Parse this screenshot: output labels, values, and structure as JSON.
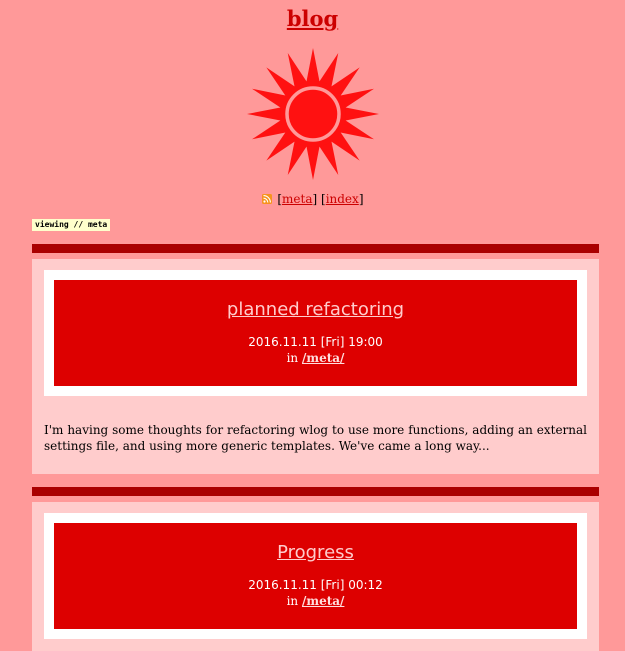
{
  "site": {
    "title": "blog"
  },
  "nav": {
    "open1": "[",
    "meta_link": "meta",
    "close1": "]",
    "open2": "[",
    "index_link": "index",
    "close2": "]"
  },
  "viewing": "viewing // meta",
  "posts": [
    {
      "title": "planned refactoring",
      "date": "2016.11.11 [Fri] 19:00",
      "in_label": "in",
      "category": "/meta/",
      "text": "I'm having some thoughts for refactoring wlog to use more functions, adding an external settings file, and using more generic templates. We've came a long way..."
    },
    {
      "title": "Progress",
      "date": "2016.11.11 [Fri] 00:12",
      "in_label": "in",
      "category": "/meta/"
    }
  ],
  "icons": {
    "logo": "sun-icon",
    "feed": "rss-icon"
  },
  "colors": {
    "page_bg": "#ff9999",
    "accent": "#cc0000",
    "header_bg": "#dd0000",
    "bar": "#aa0000",
    "post_bg": "#ffcccc"
  }
}
